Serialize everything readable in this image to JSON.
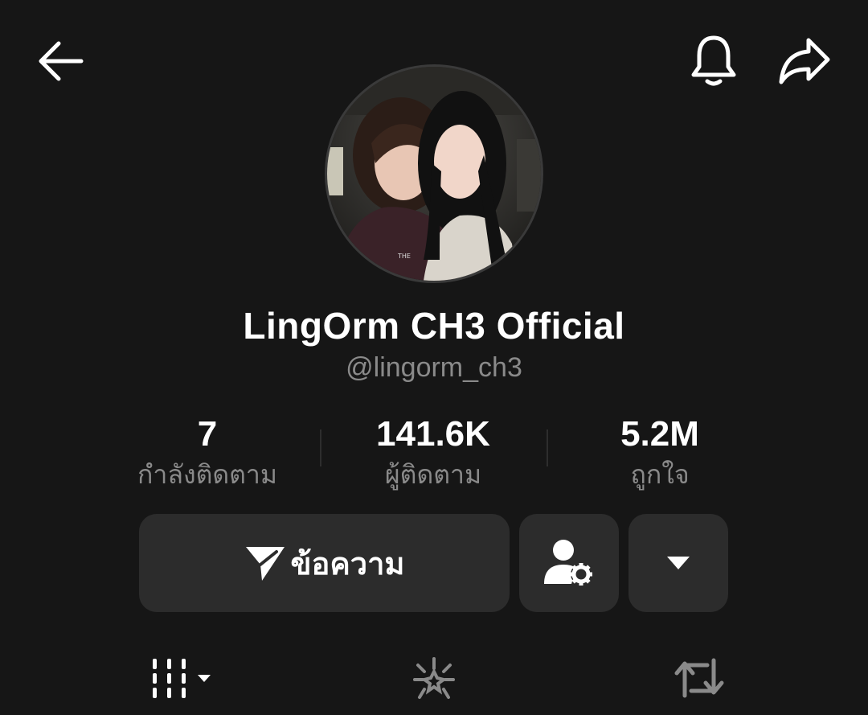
{
  "header": {
    "back_icon": "arrow-left-icon",
    "notify_icon": "bell-icon",
    "share_icon": "share-arrow-icon"
  },
  "profile": {
    "display_name": "LingOrm CH3 Official",
    "username": "@lingorm_ch3",
    "avatar": "profile-photo-two-women"
  },
  "stats": [
    {
      "value": "7",
      "label": "กำลังติดตาม"
    },
    {
      "value": "141.6K",
      "label": "ผู้ติดตาม"
    },
    {
      "value": "5.2M",
      "label": "ถูกใจ"
    }
  ],
  "actions": {
    "message_label": "ข้อความ",
    "message_icon": "send-icon",
    "user_settings_icon": "user-gear-icon",
    "more_icon": "caret-down-icon"
  },
  "tabs": [
    {
      "icon": "video-grid-icon"
    },
    {
      "icon": "sparkle-favorites-icon"
    },
    {
      "icon": "repost-icon"
    }
  ],
  "colors": {
    "background": "#161616",
    "button": "#2c2c2c",
    "text_primary": "#ffffff",
    "text_secondary": "#8a8a8a"
  }
}
